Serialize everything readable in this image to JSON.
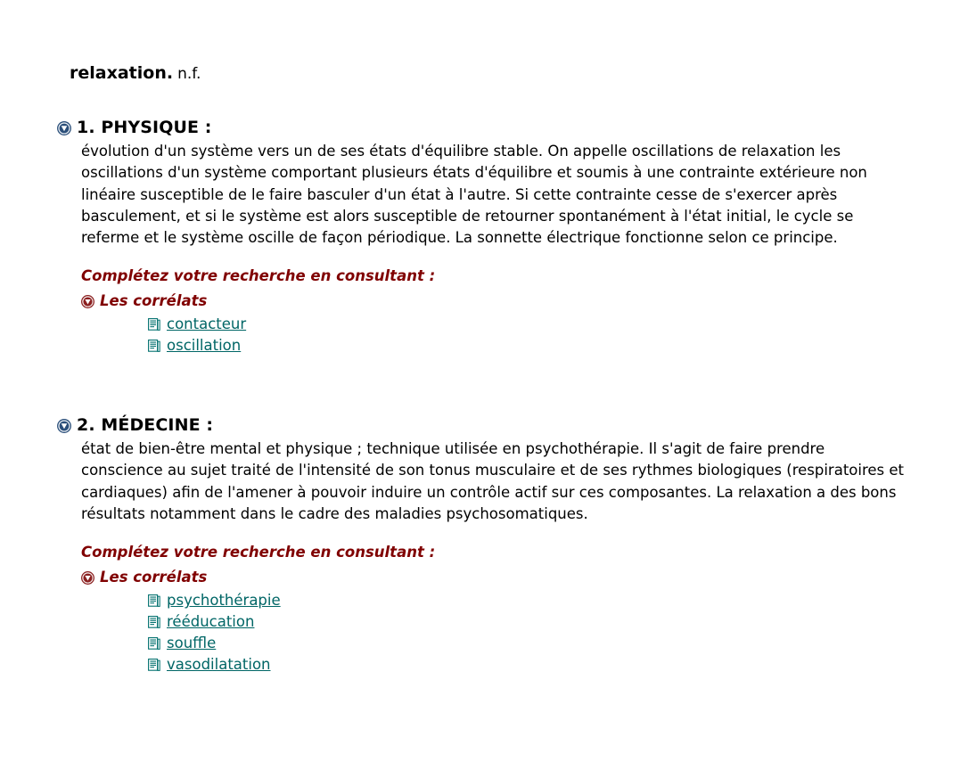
{
  "entry": {
    "headword": "relaxation.",
    "part_of_speech": "n.f."
  },
  "colors": {
    "text": "#000000",
    "link": "#006666",
    "heading_accent": "#800000",
    "bullet_blue": "#2b4f7a",
    "background": "#ffffff"
  },
  "senses": [
    {
      "heading": "1. PHYSIQUE :",
      "bullet_icon": "triangle-down-circle-blue-icon",
      "body": "évolution d'un système vers un de ses états d'équilibre stable. On appelle oscillations de relaxation les oscillations d'un système comportant plusieurs états d'équilibre et soumis à une contrainte extérieure non linéaire susceptible de le faire basculer d'un état à l'autre. Si cette contrainte cesse de s'exercer après basculement, et si le système est alors susceptible de retourner spontanément à l'état initial, le cycle se referme et le système oscille de façon périodique. La sonnette électrique fonctionne selon ce principe.",
      "complete_title": "Complétez votre recherche en consultant :",
      "correlats_label": "Les corrélats",
      "correlats_icon": "triangle-down-circle-red-icon",
      "links": [
        {
          "label": "contacteur",
          "icon": "document-icon"
        },
        {
          "label": "oscillation",
          "icon": "document-icon"
        }
      ]
    },
    {
      "heading": "2. MÉDECINE :",
      "bullet_icon": "triangle-down-circle-blue-icon",
      "body": "état de bien-être mental et physique ; technique utilisée en psychothérapie. Il s'agit de faire prendre conscience au sujet traité de l'intensité de son tonus musculaire et de ses rythmes biologiques (respiratoires et cardiaques) afin de l'amener à pouvoir induire un contrôle actif sur ces composantes. La relaxation a des bons résultats notamment dans le cadre des maladies psychosomatiques.",
      "complete_title": "Complétez votre recherche en consultant :",
      "correlats_label": "Les corrélats",
      "correlats_icon": "triangle-down-circle-red-icon",
      "links": [
        {
          "label": "psychothérapie",
          "icon": "document-icon"
        },
        {
          "label": "rééducation",
          "icon": "document-icon"
        },
        {
          "label": "souffle",
          "icon": "document-icon"
        },
        {
          "label": "vasodilatation",
          "icon": "document-icon"
        }
      ]
    }
  ]
}
